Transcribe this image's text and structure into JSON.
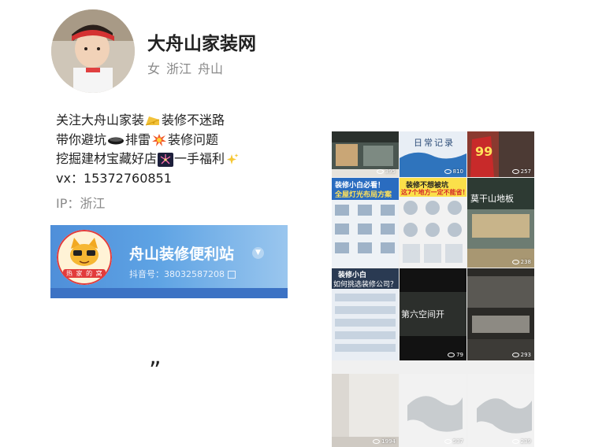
{
  "profile": {
    "name": "大舟山家装网",
    "gender": "女",
    "province": "浙江",
    "city": "舟山"
  },
  "bio": {
    "line1_a": "关注大舟山家装",
    "line1_b": "装修不迷路",
    "line2_a": "带你避坑",
    "line2_b": "排雷",
    "line2_c": "装修问题",
    "line3_a": "挖掘建材宝藏好店",
    "line3_b": "一手福利",
    "line4": "vx：15372760851",
    "icons": [
      "cheese-emoji",
      "hole-emoji",
      "collision-emoji",
      "fireworks-emoji",
      "sparkles-emoji"
    ]
  },
  "ip": "IP：浙江",
  "linked_account": {
    "title": "舟山装修便利站",
    "douyin_id": "抖音号：38032587208",
    "logo_text": "热 家 的 窝",
    "brand_color": "#4f8fd9"
  },
  "stray_mark": "”",
  "videos": [
    {
      "views": "395",
      "caption": ""
    },
    {
      "views": "810",
      "caption": "日常记录"
    },
    {
      "views": "257",
      "caption": "99"
    },
    {
      "views": "",
      "caption": "装修小白必看！",
      "subcaption": "全屋灯光布局方案"
    },
    {
      "views": "",
      "caption": "装修不想被坑",
      "subcaption": "这7个地方一定不能省！"
    },
    {
      "views": "238",
      "caption": "莫干山地板"
    },
    {
      "views": "",
      "caption": "装修小白",
      "subcaption": "如何挑选装修公司？"
    },
    {
      "views": "79",
      "caption": "第六空间开"
    },
    {
      "views": "293",
      "caption": ""
    },
    {
      "views": "1994",
      "caption": ""
    },
    {
      "views": "537",
      "caption": ""
    },
    {
      "views": "239",
      "caption": ""
    }
  ]
}
